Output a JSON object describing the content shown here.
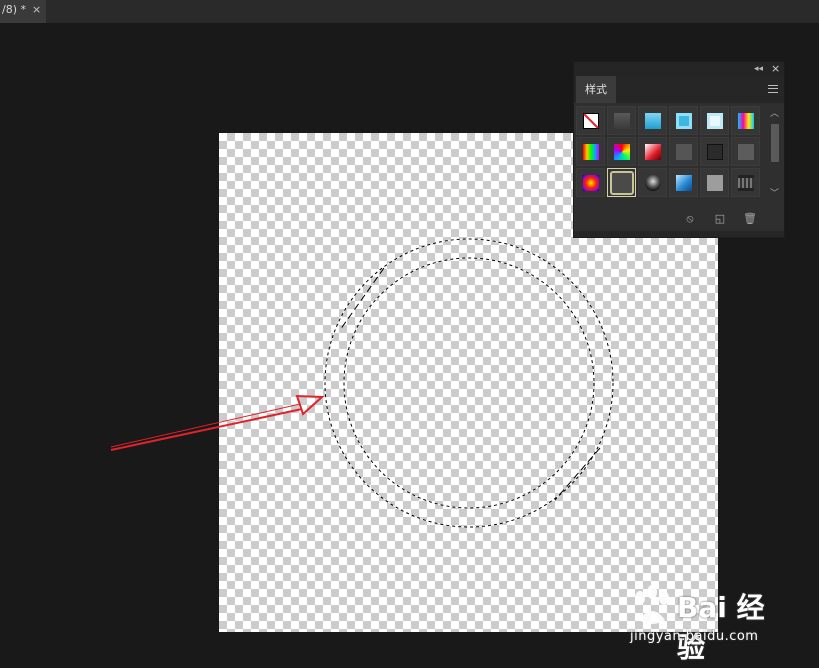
{
  "document_tab": {
    "title": "/8) *",
    "close_glyph": "×"
  },
  "styles_panel": {
    "collapse_glyph": "◂◂",
    "close_glyph": "×",
    "tab_label": "样式",
    "menu_icon": "hamburger-menu-icon",
    "swatches": [
      {
        "name": "none-style",
        "icon": "no-style-icon"
      },
      {
        "name": "dark-gray-shadow",
        "color": "#4a4a4a"
      },
      {
        "name": "cyan-gradient",
        "color": "#3fb6e0"
      },
      {
        "name": "cyan-frame",
        "color": "#4cc7ee"
      },
      {
        "name": "light-cyan-frame",
        "color": "#bfe9f7"
      },
      {
        "name": "rainbow-stripes",
        "color": "#ff00aa"
      },
      {
        "name": "vertical-rainbow",
        "color": "#ffcc00"
      },
      {
        "name": "spectrum-gradient",
        "color": "#00ff66"
      },
      {
        "name": "red-gradient",
        "color": "#e11b2a"
      },
      {
        "name": "dark-gray-bevel",
        "color": "#555555"
      },
      {
        "name": "black-stroke",
        "color": "#2b2b2b"
      },
      {
        "name": "gray-bevel",
        "color": "#5c5c5c"
      },
      {
        "name": "radial-rainbow",
        "color": "#ff2200"
      },
      {
        "name": "selected-outline",
        "color": "#4a4a4a"
      },
      {
        "name": "chrome-sphere",
        "color": "#888888"
      },
      {
        "name": "blue-glass",
        "color": "#2a8ad6"
      },
      {
        "name": "light-gray",
        "color": "#9d9d9d"
      },
      {
        "name": "film-strip",
        "color": "#444444"
      }
    ],
    "footer_icons": [
      "clear-style-icon",
      "new-style-icon",
      "delete-style-icon"
    ],
    "footer_glyphs": {
      "clear": "⦸",
      "new": "◱",
      "delete": "🗑"
    }
  },
  "watermark": {
    "brand": "Bai 经验",
    "url": "jingyan.baidu.com"
  },
  "colors": {
    "workspace": "#191919",
    "arrow": "#e0222a",
    "selection": "#000000"
  }
}
